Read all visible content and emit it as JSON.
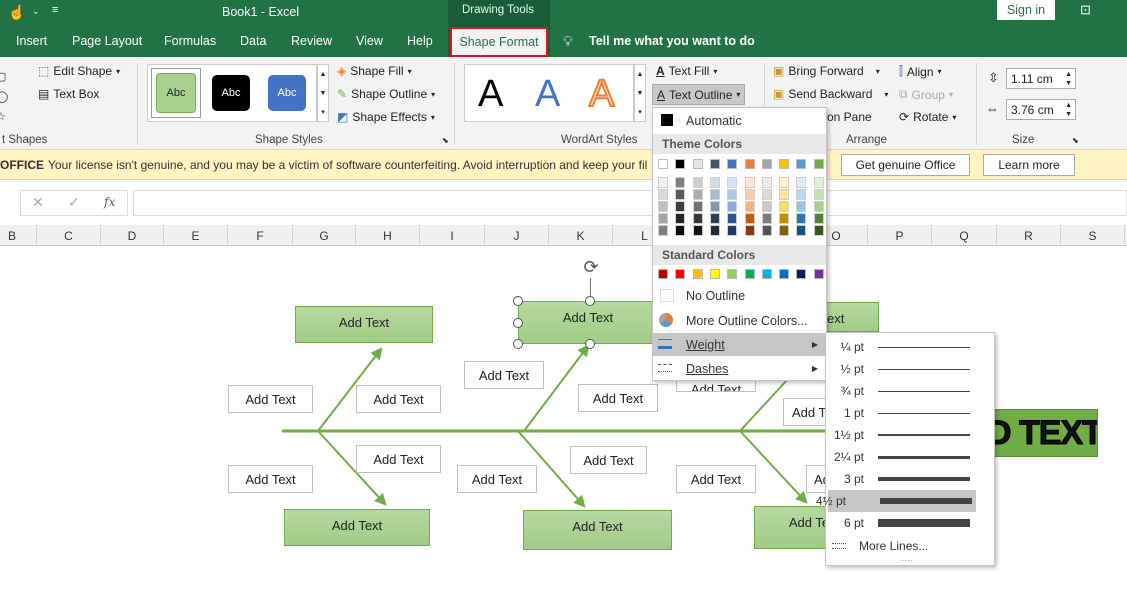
{
  "titlebar": {
    "title": "Book1  -  Excel",
    "context_tab": "Drawing Tools",
    "signin": "Sign in"
  },
  "tabs": [
    "Insert",
    "Page Layout",
    "Formulas",
    "Data",
    "Review",
    "View",
    "Help",
    "Shape Format"
  ],
  "tell_me": "Tell me what you want to do",
  "ribbon": {
    "insert_shapes": {
      "edit_shape": "Edit Shape",
      "text_box": "Text Box",
      "label": "t Shapes"
    },
    "shape_styles": {
      "swatch_label": "Abc",
      "shape_fill": "Shape Fill",
      "shape_outline": "Shape Outline",
      "shape_effects": "Shape Effects",
      "label": "Shape Styles"
    },
    "wordart": {
      "letter": "A",
      "text_fill": "Text Fill",
      "text_outline": "Text Outline",
      "label": "WordArt Styles"
    },
    "arrange": {
      "bring_forward": "Bring Forward",
      "send_backward": "Send Backward",
      "selection_pane": "on Pane",
      "align": "Align",
      "group": "Group",
      "rotate": "Rotate",
      "label": "Arrange"
    },
    "size": {
      "height": "1.11 cm",
      "width": "3.76 cm",
      "label": "Size"
    }
  },
  "message_bar": {
    "label": "OFFICE",
    "text": "Your license isn't genuine, and you may be a victim of software counterfeiting. Avoid interruption and keep your fil",
    "genuine_button": "Get genuine Office",
    "learn_more": "Learn more"
  },
  "formula_bar": {
    "fx": "fx"
  },
  "columns": [
    "B",
    "C",
    "D",
    "E",
    "F",
    "G",
    "H",
    "I",
    "J",
    "K",
    "L",
    "M",
    "N",
    "O",
    "P",
    "Q",
    "R",
    "S"
  ],
  "diagram": {
    "box_text": "Add Text",
    "partial_text": "ext",
    "wordart_text": "D TEXT"
  },
  "outline_menu": {
    "automatic": "Automatic",
    "theme_header": "Theme Colors",
    "theme_top": [
      "#ffffff",
      "#000000",
      "#e7e6e6",
      "#44546a",
      "#4472c4",
      "#ed7d31",
      "#a5a5a5",
      "#ffc000",
      "#5b9bd5",
      "#70ad47"
    ],
    "theme_shades": [
      [
        "#f2f2f2",
        "#7f7f7f",
        "#d0cece",
        "#d6dce4",
        "#d9e2f3",
        "#fbe5d5",
        "#ededed",
        "#fff2cc",
        "#deebf6",
        "#e2efd9"
      ],
      [
        "#d8d8d8",
        "#595959",
        "#aeabab",
        "#adb9ca",
        "#b4c6e7",
        "#f7cbac",
        "#dbdbdb",
        "#fee599",
        "#bdd7ee",
        "#c5e0b3"
      ],
      [
        "#bfbfbf",
        "#3f3f3f",
        "#757070",
        "#8496b0",
        "#8eaadb",
        "#f4b183",
        "#c9c9c9",
        "#ffd965",
        "#9cc3e5",
        "#a8d08d"
      ],
      [
        "#a5a5a5",
        "#262626",
        "#3a3838",
        "#323f4f",
        "#2f5496",
        "#c55a11",
        "#7b7b7b",
        "#bf9000",
        "#2e75b5",
        "#538135"
      ],
      [
        "#7f7f7f",
        "#0c0c0c",
        "#171616",
        "#222a35",
        "#1f3864",
        "#833c0b",
        "#525252",
        "#7f6000",
        "#1e4e79",
        "#375623"
      ]
    ],
    "standard_header": "Standard Colors",
    "standard": [
      "#c00000",
      "#ff0000",
      "#ffc000",
      "#ffff00",
      "#92d050",
      "#00b050",
      "#00b0f0",
      "#0070c0",
      "#002060",
      "#7030a0"
    ],
    "no_outline": "No Outline",
    "more_colors": "More Outline Colors...",
    "weight": "Weight",
    "dashes": "Dashes"
  },
  "weight_menu": {
    "items": [
      {
        "label": "¼ pt",
        "pt": 0.25
      },
      {
        "label": "½ pt",
        "pt": 0.5
      },
      {
        "label": "¾ pt",
        "pt": 0.75
      },
      {
        "label": "1 pt",
        "pt": 1
      },
      {
        "label": "1½ pt",
        "pt": 1.5
      },
      {
        "label": "2¼ pt",
        "pt": 2.25
      },
      {
        "label": "3 pt",
        "pt": 3
      },
      {
        "label": "4½ pt",
        "pt": 4.5
      },
      {
        "label": "6 pt",
        "pt": 6
      }
    ],
    "selected": "4½ pt",
    "more_lines": "More Lines..."
  },
  "colors": {
    "excel_green": "#217346",
    "highlight_red": "#e81123",
    "diagram_green": "#70ad47",
    "box_fill": "#a9d18e",
    "message_bg": "#fff4c4"
  }
}
